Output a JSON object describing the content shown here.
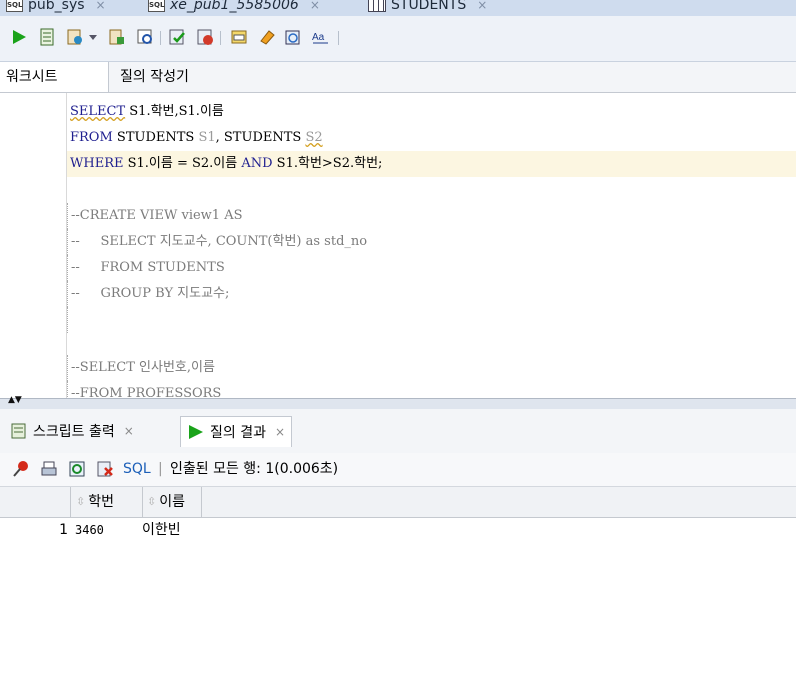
{
  "doc_tabs": [
    {
      "label": "pub_sys",
      "close": "×"
    },
    {
      "label": "xe_pub1_5585006",
      "close": "×"
    },
    {
      "label": "STUDENTS",
      "close": "×"
    }
  ],
  "editor_tabs": {
    "worksheet": "워크시트",
    "query_builder": "질의 작성기"
  },
  "code_lines": [
    [
      "SELECT",
      " S1.학번,S1.이름"
    ],
    [
      "FROM",
      " STUDENTS ",
      "S1",
      ", STUDENTS ",
      "S2"
    ],
    [
      "WHERE",
      " S1.이름 = S2.이름 ",
      "AND",
      " S1.학번>S2.학번;"
    ],
    "",
    "--CREATE VIEW view1 AS",
    "--     SELECT 지도교수, COUNT(학번) as std_no",
    "--     FROM STUDENTS",
    "--     GROUP BY 지도교수;",
    "",
    "--SELECT 인사번호,이름",
    "--FROM PROFESSORS"
  ],
  "output_tabs": {
    "script_output": "스크립트 출력",
    "query_result": "질의 결과",
    "close": "×"
  },
  "result_toolbar": {
    "sql_link": "SQL",
    "status": "인출된 모든 행: 1(0.006초)"
  },
  "result_grid": {
    "columns": [
      "학번",
      "이름"
    ],
    "rows": [
      {
        "num": "1",
        "cells": [
          "3460",
          "이한빈"
        ]
      }
    ]
  }
}
